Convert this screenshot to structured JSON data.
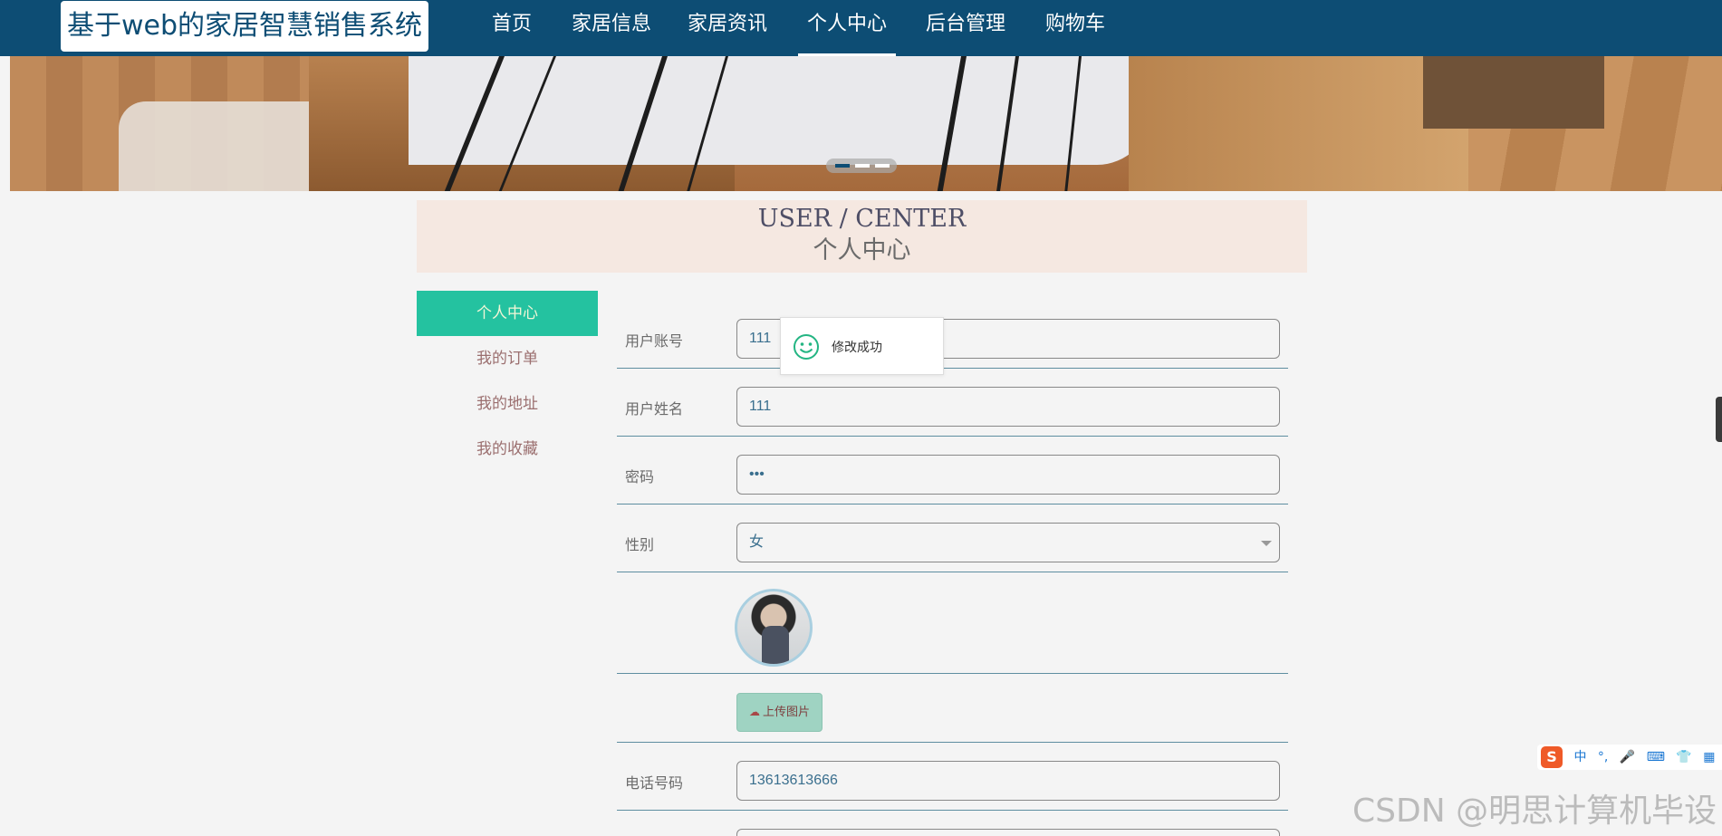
{
  "site": {
    "logo_text": "基于web的家居智慧销售系统"
  },
  "nav": {
    "items": [
      {
        "label": "首页"
      },
      {
        "label": "家居信息"
      },
      {
        "label": "家居资讯"
      },
      {
        "label": "个人中心",
        "active": true
      },
      {
        "label": "后台管理"
      },
      {
        "label": "购物车"
      }
    ]
  },
  "banner": {
    "slides": 3,
    "active_slide": 1
  },
  "section": {
    "title_en": "USER / CENTER",
    "title_cn": "个人中心"
  },
  "sidebar": {
    "items": [
      {
        "label": "个人中心",
        "active": true
      },
      {
        "label": "我的订单"
      },
      {
        "label": "我的地址"
      },
      {
        "label": "我的收藏"
      }
    ]
  },
  "form": {
    "account": {
      "label": "用户账号",
      "value": "111"
    },
    "name": {
      "label": "用户姓名",
      "value": "111"
    },
    "password": {
      "label": "密码",
      "value": "•••"
    },
    "gender": {
      "label": "性别",
      "value": "女"
    },
    "upload": {
      "label": "上传图片"
    },
    "phone": {
      "label": "电话号码",
      "value": "13613613666"
    }
  },
  "toast": {
    "message": "修改成功"
  },
  "ime": {
    "logo": "S",
    "lang": "中",
    "punct": "°,"
  },
  "watermark": "CSDN @明思计算机毕设",
  "colors": {
    "nav_bg": "#0d4d74",
    "accent": "#24c2a0",
    "title_bg": "#f5e8e1"
  }
}
